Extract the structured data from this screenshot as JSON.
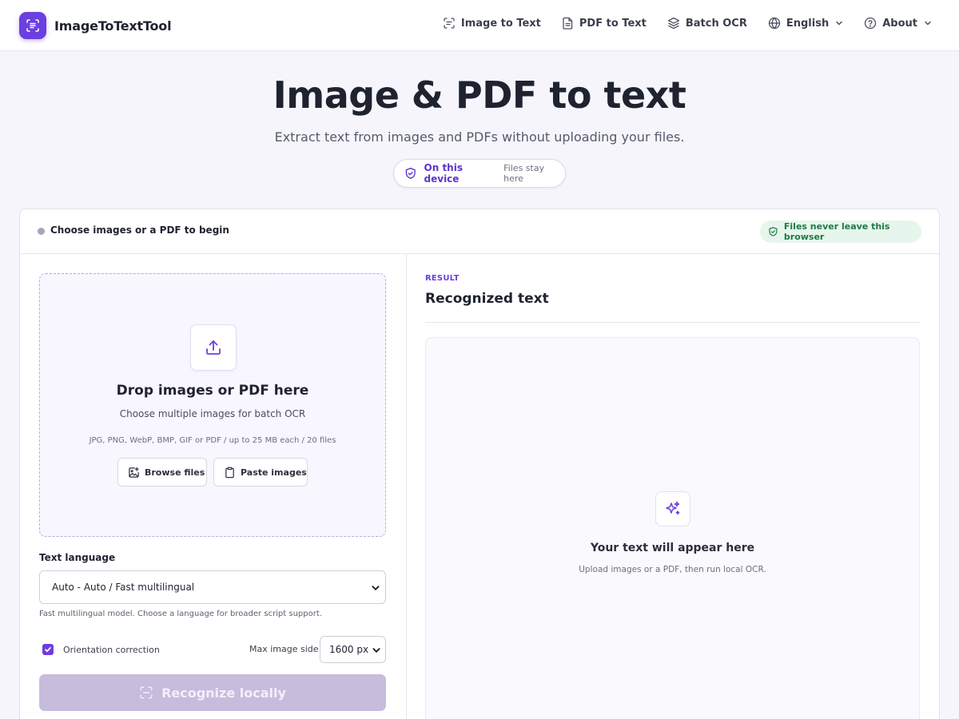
{
  "brand": {
    "name": "ImageToTextTool",
    "logo_icon": "scan-text-icon",
    "accent": "#6c3fe0"
  },
  "nav": {
    "items": [
      {
        "label": "Image to Text",
        "icon": "scan-icon"
      },
      {
        "label": "PDF to Text",
        "icon": "document-icon"
      },
      {
        "label": "Batch OCR",
        "icon": "layers-icon"
      },
      {
        "label": "English",
        "icon": "globe-icon",
        "dropdown": true
      },
      {
        "label": "About",
        "icon": "help-circle-icon",
        "dropdown": true
      }
    ]
  },
  "hero": {
    "title": "Image & PDF to text",
    "subtitle": "Extract text from images and PDFs without uploading your files.",
    "pill_strong": "On this device",
    "pill_muted": "Files stay here"
  },
  "card": {
    "status": "Choose images or a PDF to begin",
    "privacy_badge": "Files never leave this browser",
    "privacy_color": "#1f7a45"
  },
  "dropzone": {
    "title": "Drop images or PDF here",
    "subtitle": "Choose multiple images for batch OCR",
    "formats": "JPG, PNG, WebP, BMP, GIF or PDF / up to 25 MB each / 20 files",
    "browse_label": "Browse files",
    "paste_label": "Paste images"
  },
  "options": {
    "language_label": "Text language",
    "language_value": "Auto - Auto / Fast multilingual",
    "language_hint": "Fast multilingual model. Choose a language for broader script support.",
    "orientation_label": "Orientation correction",
    "orientation_checked": true,
    "max_side_label": "Max image side",
    "max_side_value": "1600 px"
  },
  "action": {
    "recognize_label": "Recognize locally",
    "disabled": true
  },
  "result": {
    "kicker": "RESULT",
    "title": "Recognized text",
    "empty_title": "Your text will appear here",
    "empty_subtitle": "Upload images or a PDF, then run local OCR."
  }
}
